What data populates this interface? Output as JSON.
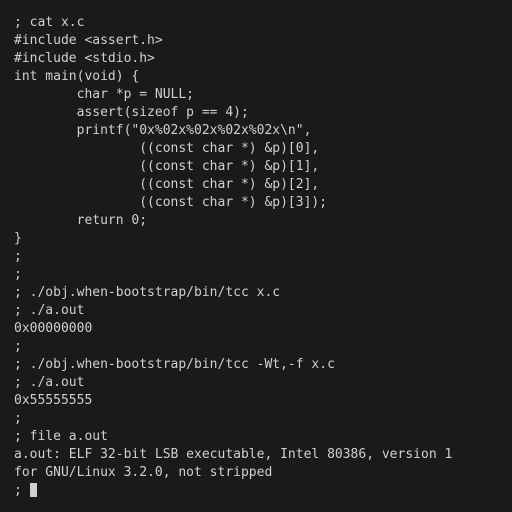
{
  "terminal": {
    "lines": [
      "; cat x.c",
      "#include <assert.h>",
      "#include <stdio.h>",
      "int main(void) {",
      "        char *p = NULL;",
      "        assert(sizeof p == 4);",
      "        printf(\"0x%02x%02x%02x%02x\\n\",",
      "                ((const char *) &p)[0],",
      "                ((const char *) &p)[1],",
      "                ((const char *) &p)[2],",
      "                ((const char *) &p)[3]);",
      "        return 0;",
      "}",
      ";",
      ";",
      "; ./obj.when-bootstrap/bin/tcc x.c",
      "; ./a.out",
      "0x00000000",
      ";",
      "; ./obj.when-bootstrap/bin/tcc -Wt,-f x.c",
      "; ./a.out",
      "0x55555555",
      ";",
      "; file a.out",
      "a.out: ELF 32-bit LSB executable, Intel 80386, version 1",
      "for GNU/Linux 3.2.0, not stripped",
      "; "
    ]
  }
}
